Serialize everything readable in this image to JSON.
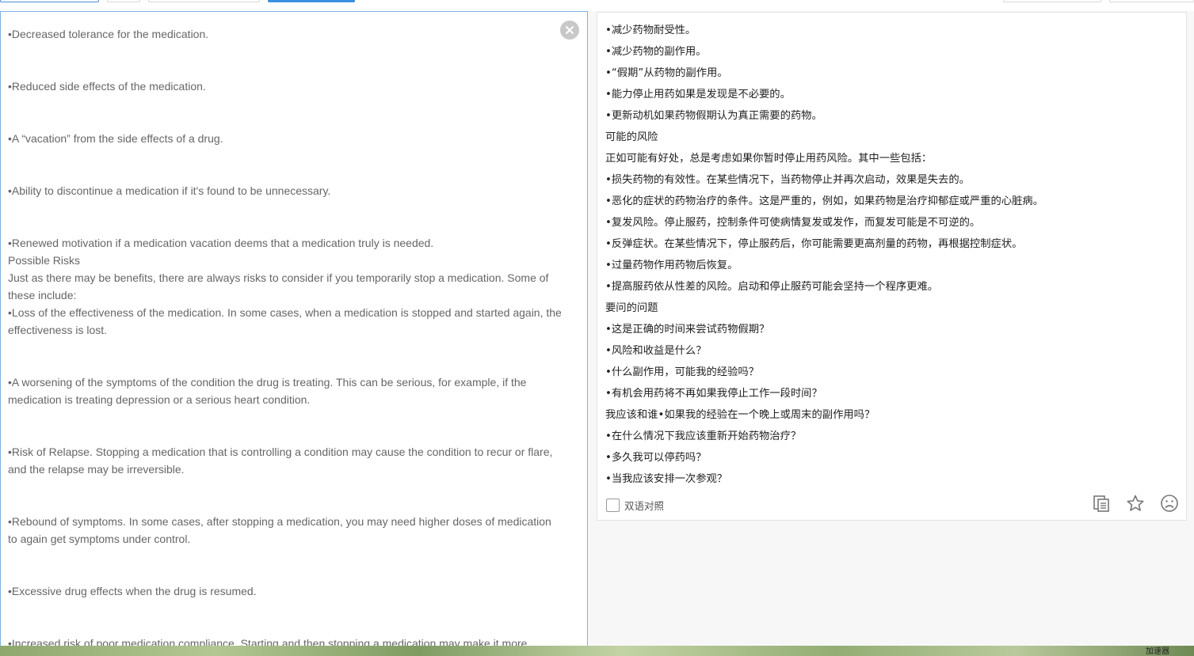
{
  "source": {
    "text": "•Decreased tolerance for the medication.\n\n\n•Reduced side effects of the medication.\n\n\n•A “vacation” from the side effects of a drug.\n\n\n•Ability to discontinue a medication if it's found to be unnecessary.\n\n\n•Renewed motivation if a medication vacation deems that a medication truly is needed.\nPossible Risks\nJust as there may be benefits, there are always risks to consider if you temporarily stop a medication. Some of these include:\n•Loss of the effectiveness of the medication. In some cases, when a medication is stopped and started again, the effectiveness is lost.\n\n\n•A worsening of the symptoms of the condition the drug is treating. This can be serious, for example, if the medication is treating depression or a serious heart condition.\n\n\n•Risk of Relapse. Stopping a medication that is controlling a condition may cause the condition to recur or flare, and the relapse may be irreversible.\n\n\n•Rebound of symptoms. In some cases, after stopping a medication, you may need higher doses of medication to again get symptoms under control.\n\n\n•Excessive drug effects when the drug is resumed.\n\n\n•Increased risk of poor medication compliance. Starting and then stopping a medication may make it more"
  },
  "result": {
    "lines": [
      "•减少药物耐受性。",
      "•减少药物的副作用。",
      "•“假期”从药物的副作用。",
      "•能力停止用药如果是发现是不必要的。",
      "•更新动机如果药物假期认为真正需要的药物。",
      "可能的风险",
      "正如可能有好处，总是考虑如果你暂时停止用药风险。其中一些包括：",
      "•损失药物的有效性。在某些情况下，当药物停止并再次启动，效果是失去的。",
      "•恶化的症状的药物治疗的条件。这是严重的，例如，如果药物是治疗抑郁症或严重的心脏病。",
      "•复发风险。停止服药，控制条件可使病情复发或发作，而复发可能是不可逆的。",
      "•反弹症状。在某些情况下，停止服药后，你可能需要更高剂量的药物，再根据控制症状。",
      "•过量药物作用药物后恢复。",
      "•提高服药依从性差的风险。启动和停止服药可能会坚持一个程序更难。",
      "要问的问题",
      "•这是正确的时间来尝试药物假期？",
      "•风险和收益是什么？",
      "•什么副作用，可能我的经验吗？",
      "•有机会用药将不再如果我停止工作一段时间？",
      "我应该和谁•如果我的经验在一个晚上或周末的副作用吗？",
      "•在什么情况下我应该重新开始药物治疗？",
      "•多久我可以停药吗？",
      "•当我应该安排一次参观？"
    ],
    "bilingual_label": "双语对照",
    "bilingual_checked": false
  },
  "icons": {
    "clear": "close-circle-icon",
    "copy": "copy-icon",
    "favorite": "star-icon",
    "feedback": "sad-face-icon"
  },
  "taskbar": {
    "text": "加速器"
  },
  "colors": {
    "accent": "#3b8fe0",
    "pane_border": "#7fb2e5",
    "source_text": "#666666",
    "result_text": "#222222"
  }
}
